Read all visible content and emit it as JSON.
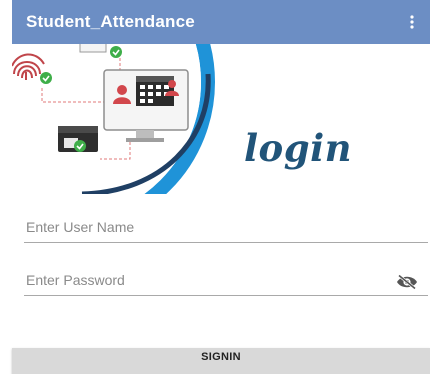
{
  "app_bar": {
    "title": "Student_Attendance",
    "background_color": "#6c8ec4",
    "menu_icon": "more-vert-icon"
  },
  "hero": {
    "logo_text": "login",
    "logo_color": "#215479",
    "ring_color": "#1f93d8",
    "illustration_icons": [
      "fingerprint-icon",
      "calendar-icon",
      "monitor-icon",
      "id-card-icon",
      "user-icon",
      "checkmark-icon"
    ]
  },
  "form": {
    "username_placeholder": "Enter User Name",
    "username_value": "",
    "password_placeholder": "Enter Password",
    "password_value": "",
    "password_toggle_icon": "eye-off-icon",
    "signin_label": "SIGNIN"
  }
}
